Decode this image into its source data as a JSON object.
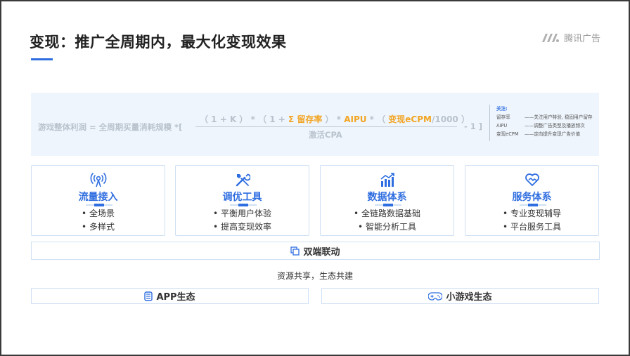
{
  "header": {
    "title": "变现：推广全周期内，最大化变现效果",
    "brand": "腾讯广告"
  },
  "formula": {
    "lhs": "游戏整体利润 = 全周期买量消耗规模  *[",
    "num_p1": "（ 1 + K ）  *  （ 1 + ",
    "num_hl1": "Σ 留存率",
    "num_p2": " ）  *  ",
    "num_hl2": "AIPU",
    "num_p3": "  *  （ ",
    "num_hl3": "变现eCPM",
    "num_p4": "/1000 ）",
    "denominator": "激活CPA",
    "close": "- 1  ]"
  },
  "notes": {
    "title": "关注:",
    "rows": [
      {
        "key": "留存率",
        "val": "——关注用户特验, 稳固用户留存"
      },
      {
        "key": "AIPU",
        "val": "——调整广告类型及播放频次"
      },
      {
        "key": "变现eCPM",
        "val": "——定向提升变现广告价值"
      }
    ]
  },
  "cards": [
    {
      "title": "流量接入",
      "items": [
        "• 全场景",
        "• 多样式"
      ],
      "icon": "signal-icon"
    },
    {
      "title": "调优工具",
      "items": [
        "• 平衡用户体验",
        "• 提高变现效率"
      ],
      "icon": "tools-icon"
    },
    {
      "title": "数据体系",
      "items": [
        "• 全链路数据基础",
        "• 智能分析工具"
      ],
      "icon": "chart-icon"
    },
    {
      "title": "服务体系",
      "items": [
        "• 专业变现辅导",
        "• 平台服务工具"
      ],
      "icon": "handshake-icon"
    }
  ],
  "linkage": {
    "label": "双端联动"
  },
  "middle": "资源共享，生态共建",
  "ecosystems": {
    "app": "APP生态",
    "minigame": "小游戏生态"
  },
  "colors": {
    "accent": "#2f6ee0",
    "highlight": "#f2a524",
    "panel": "#eef5fd"
  }
}
